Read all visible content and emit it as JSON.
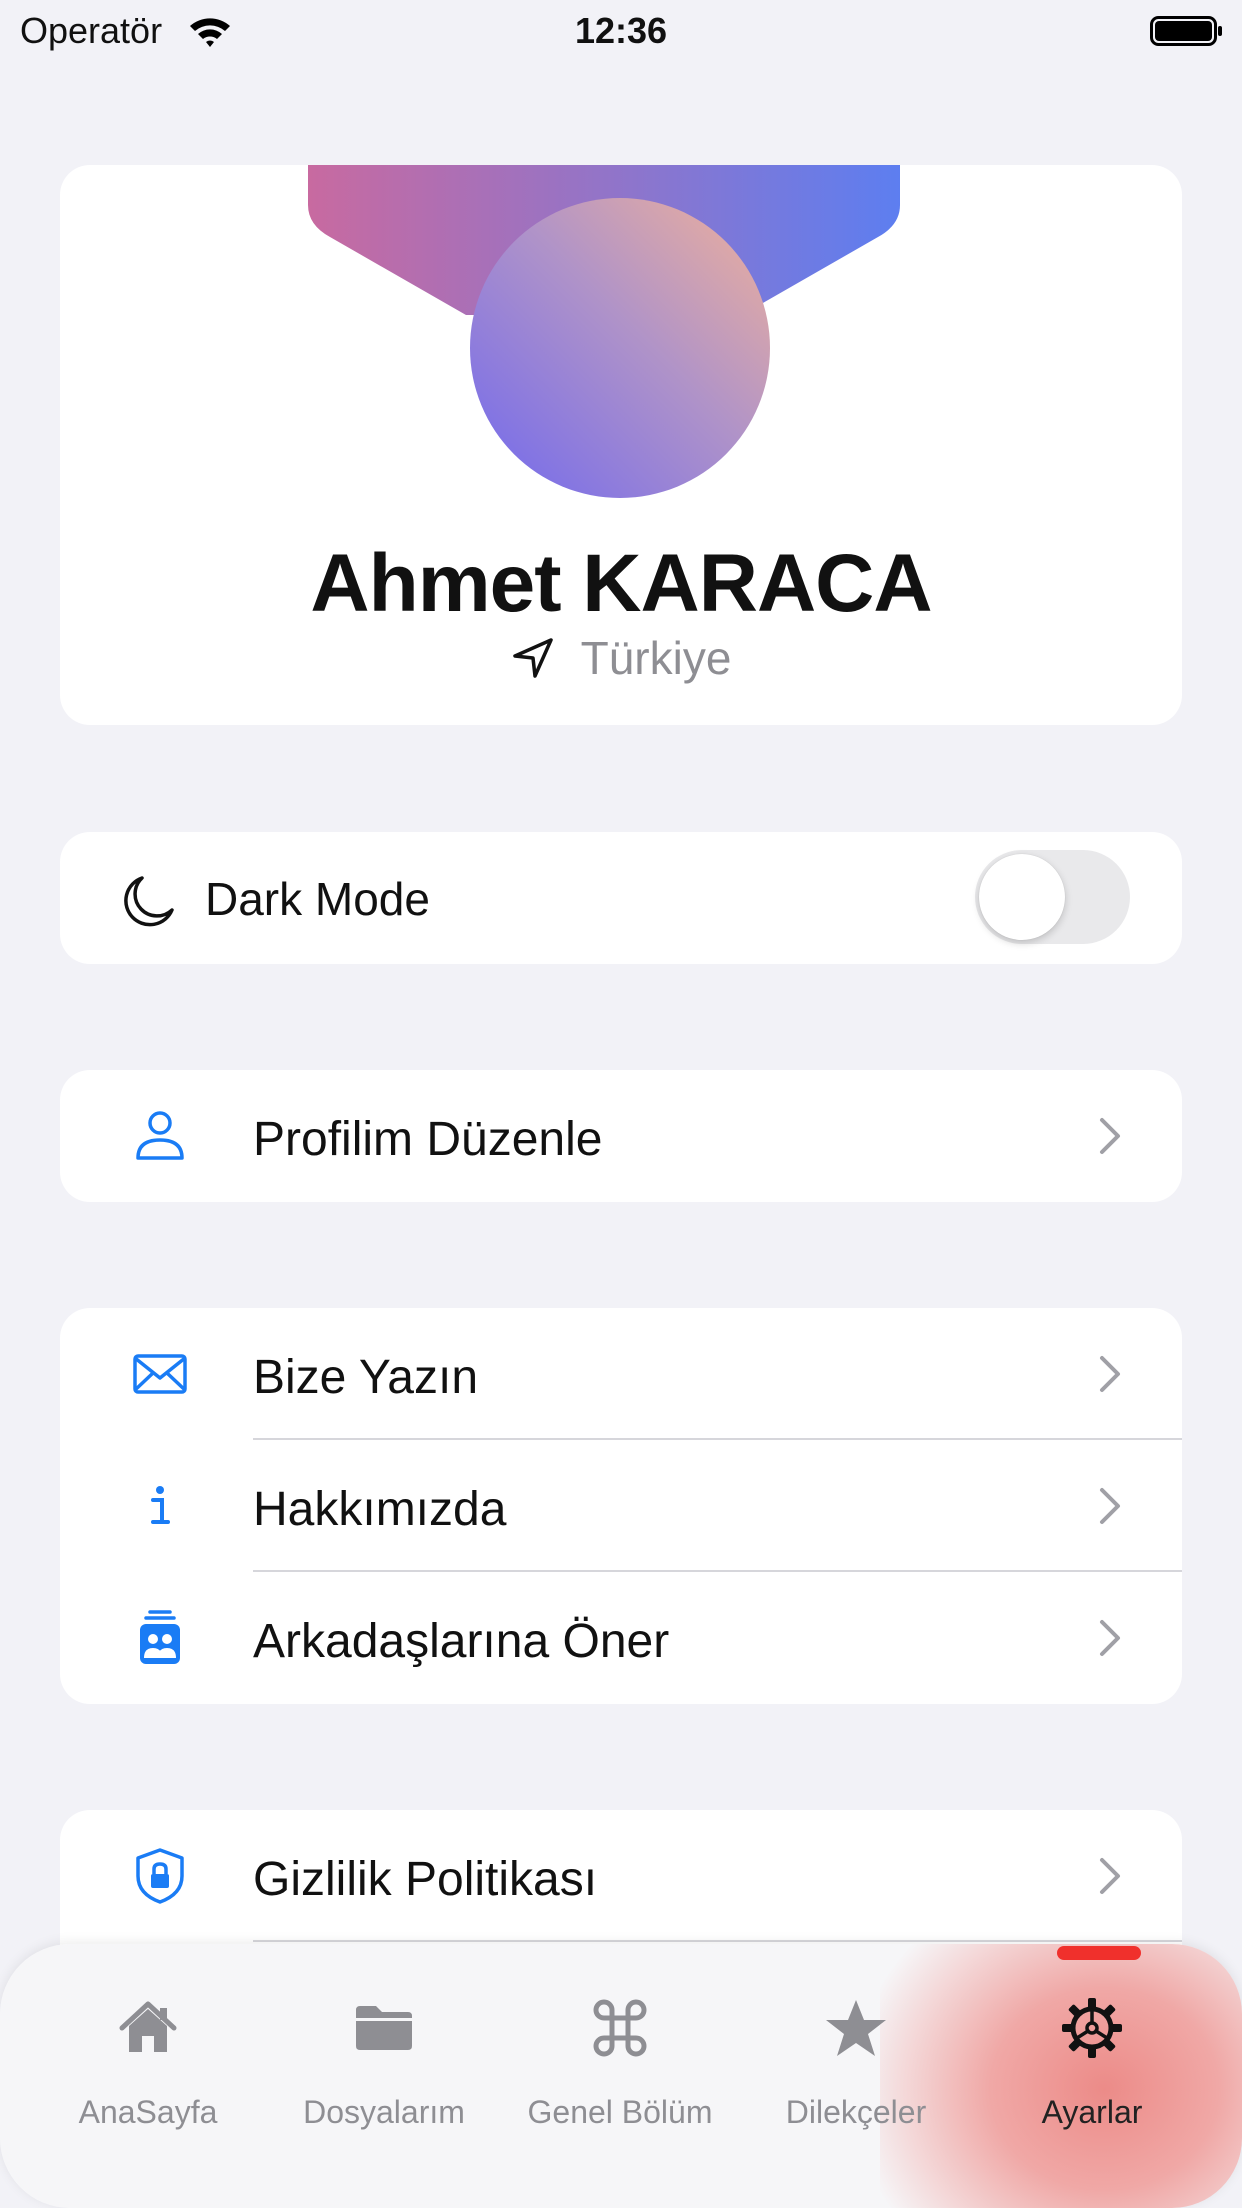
{
  "status_bar": {
    "carrier": "Operatör",
    "time": "12:36"
  },
  "profile": {
    "name": "Ahmet KARACA",
    "location": "Türkiye"
  },
  "dark_mode": {
    "label": "Dark Mode",
    "enabled": false
  },
  "menu": {
    "edit_profile": "Profilim Düzenle",
    "contact": "Bize Yazın",
    "about": "Hakkımızda",
    "recommend": "Arkadaşlarına Öner",
    "privacy": "Gizlilik Politikası"
  },
  "tabs": [
    {
      "label": "AnaSayfa",
      "icon": "home-icon"
    },
    {
      "label": "Dosyalarım",
      "icon": "folder-icon"
    },
    {
      "label": "Genel Bölüm",
      "icon": "command-icon"
    },
    {
      "label": "Dilekçeler",
      "icon": "star-icon"
    },
    {
      "label": "Ayarlar",
      "icon": "gear-icon",
      "active": true
    }
  ],
  "colors": {
    "accent": "#1a7cf5",
    "tab_highlight": "#f0302c",
    "background": "#f2f2f7"
  }
}
